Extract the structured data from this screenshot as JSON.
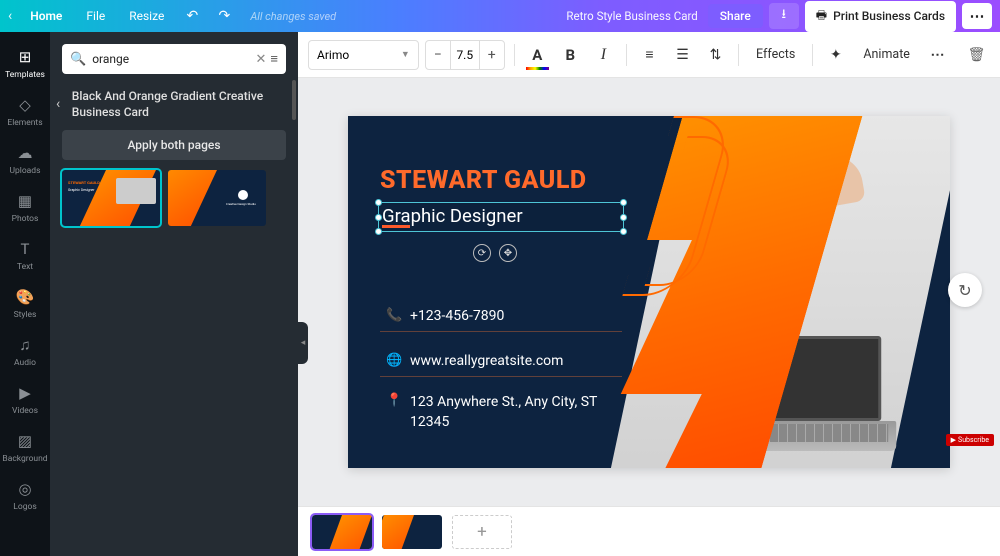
{
  "nav": {
    "home": "Home",
    "file": "File",
    "resize": "Resize",
    "saved": "All changes saved",
    "doc_title": "Retro Style Business Card",
    "share": "Share",
    "print": "Print Business Cards"
  },
  "rail": {
    "templates": "Templates",
    "elements": "Elements",
    "uploads": "Uploads",
    "photos": "Photos",
    "text": "Text",
    "styles": "Styles",
    "audio": "Audio",
    "videos": "Videos",
    "background": "Background",
    "logos": "Logos"
  },
  "search": {
    "value": "orange"
  },
  "template": {
    "name": "Black And Orange Gradient Creative Business Card",
    "apply": "Apply both pages"
  },
  "toolbar": {
    "font": "Arimo",
    "size": "7.5",
    "effects": "Effects",
    "animate": "Animate"
  },
  "card": {
    "name": "STEWART GAULD",
    "role": "Graphic Designer",
    "phone": "+123-456-7890",
    "website": "www.reallygreatsite.com",
    "address": "123 Anywhere St., Any City, ST 12345"
  },
  "misc": {
    "subscribe": "Subscribe"
  }
}
